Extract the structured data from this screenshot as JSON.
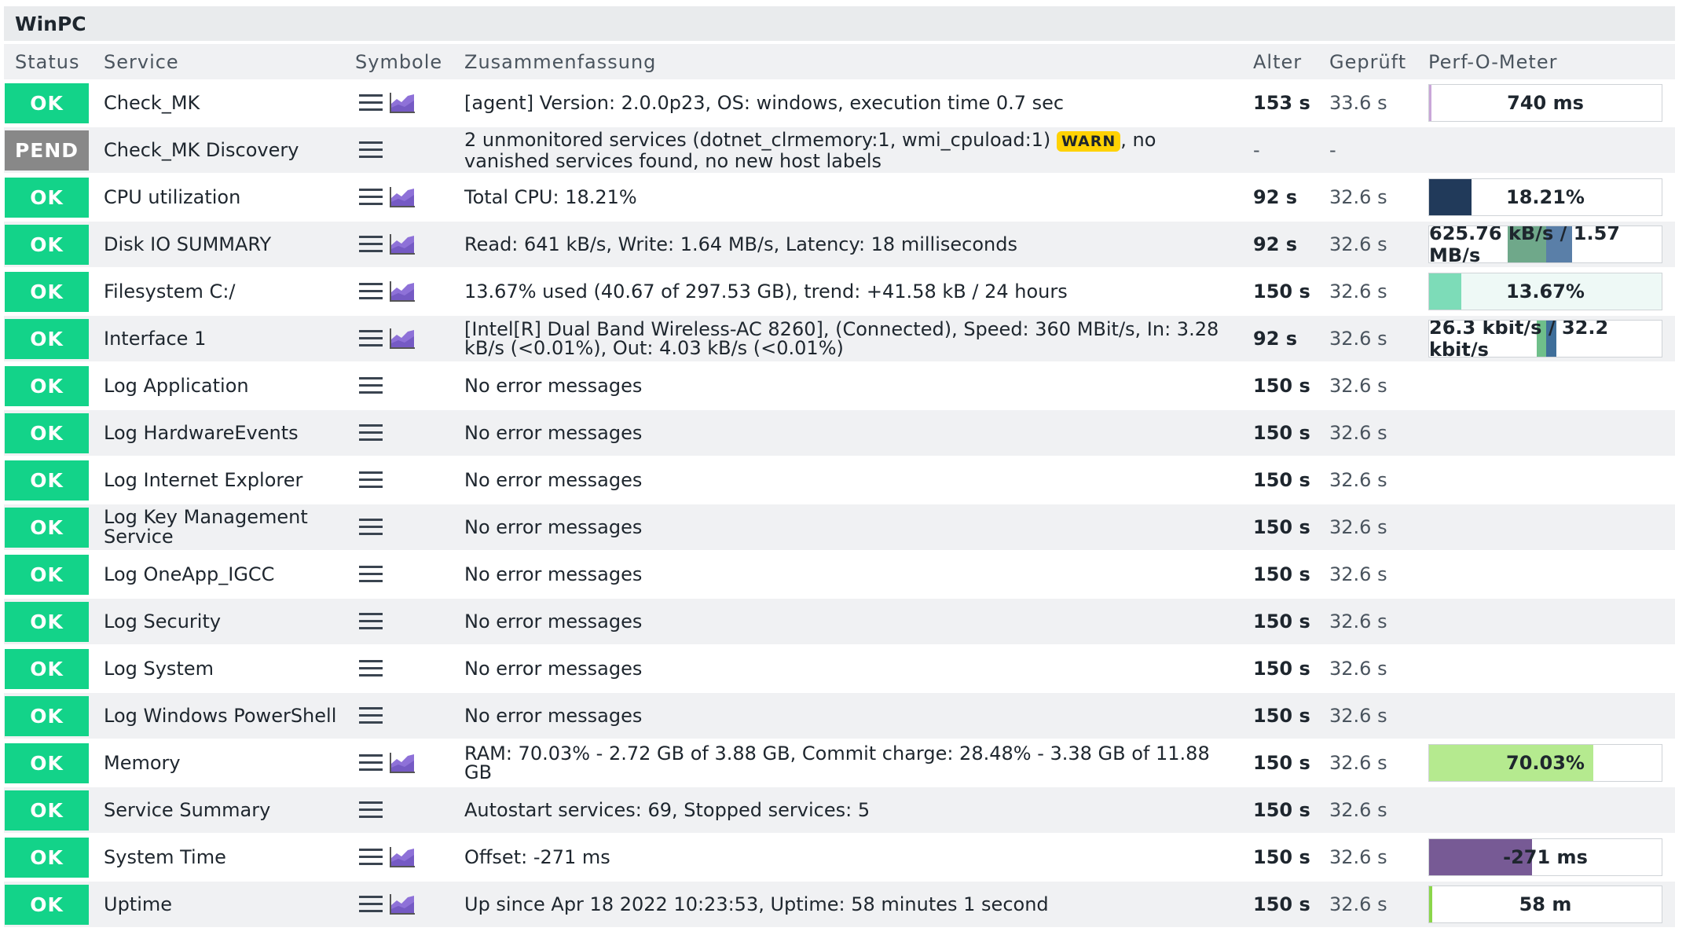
{
  "host": {
    "name": "WinPC"
  },
  "columns": {
    "status": "Status",
    "service": "Service",
    "symbols": "Symbole",
    "summary": "Zusammenfassung",
    "age": "Alter",
    "checked": "Geprüft",
    "perf": "Perf-O-Meter"
  },
  "colors": {
    "ok": "#13d389",
    "pend": "#888888",
    "warn": "#ffd203",
    "graph_icon": "#8e71d8"
  },
  "rows": [
    {
      "status": "OK",
      "service": "Check_MK",
      "graph": true,
      "summary": "[agent] Version: 2.0.0p23, OS: windows, execution time 0.7 sec",
      "age": "153 s",
      "checked": "33.6 s",
      "perf": {
        "label": "740 ms",
        "value": 0.01,
        "color": "#c9a7d8"
      }
    },
    {
      "status": "PEND",
      "service": "Check_MK Discovery",
      "graph": false,
      "summary": "2 unmonitored services (dotnet_clrmemory:1, wmi_cpuload:1)",
      "warn": "WARN",
      "summary_after": ", no vanished services found, no new host labels",
      "age": "-",
      "checked": "-",
      "perf": null
    },
    {
      "status": "OK",
      "service": "CPU utilization",
      "graph": true,
      "summary": "Total CPU: 18.21%",
      "age": "92 s",
      "checked": "32.6 s",
      "perf": {
        "label": "18.21%",
        "value": 0.1821,
        "color": "#213a5a"
      }
    },
    {
      "status": "OK",
      "service": "Disk IO SUMMARY",
      "graph": true,
      "summary": "Read: 641 kB/s, Write: 1.64 MB/s, Latency: 18 milliseconds",
      "age": "92 s",
      "checked": "32.6 s",
      "perf": {
        "label": "625.76 kB/s / 1.57 MB/s",
        "value": 0.33,
        "color": "#6fa88a",
        "value2": 0.22,
        "color2": "#5a7fa8"
      }
    },
    {
      "status": "OK",
      "service": "Filesystem C:/",
      "graph": true,
      "summary": "13.67% used (40.67 of 297.53 GB), trend: +41.58 kB / 24 hours",
      "age": "150 s",
      "checked": "32.6 s",
      "perf": {
        "label": "13.67%",
        "value": 0.1367,
        "color": "#7ddcb8",
        "rest_color": "#eef9f6"
      }
    },
    {
      "status": "OK",
      "service": "Interface 1",
      "graph": true,
      "summary": "[Intel[R] Dual Band Wireless-AC 8260], (Connected), Speed: 360 MBit/s, In: 3.28 kB/s (<0.01%), Out: 4.03 kB/s (<0.01%)",
      "age": "92 s",
      "checked": "32.6 s",
      "perf": {
        "label": "26.3 kbit/s / 32.2 kbit/s",
        "value": 0.08,
        "color": "#6fbf8a",
        "value2": 0.09,
        "color2": "#3f6f9a"
      }
    },
    {
      "status": "OK",
      "service": "Log Application",
      "graph": false,
      "summary": "No error messages",
      "age": "150 s",
      "checked": "32.6 s",
      "perf": null
    },
    {
      "status": "OK",
      "service": "Log HardwareEvents",
      "graph": false,
      "summary": "No error messages",
      "age": "150 s",
      "checked": "32.6 s",
      "perf": null
    },
    {
      "status": "OK",
      "service": "Log Internet Explorer",
      "graph": false,
      "summary": "No error messages",
      "age": "150 s",
      "checked": "32.6 s",
      "perf": null
    },
    {
      "status": "OK",
      "service": "Log Key Management Service",
      "graph": false,
      "summary": "No error messages",
      "age": "150 s",
      "checked": "32.6 s",
      "perf": null
    },
    {
      "status": "OK",
      "service": "Log OneApp_IGCC",
      "graph": false,
      "summary": "No error messages",
      "age": "150 s",
      "checked": "32.6 s",
      "perf": null
    },
    {
      "status": "OK",
      "service": "Log Security",
      "graph": false,
      "summary": "No error messages",
      "age": "150 s",
      "checked": "32.6 s",
      "perf": null
    },
    {
      "status": "OK",
      "service": "Log System",
      "graph": false,
      "summary": "No error messages",
      "age": "150 s",
      "checked": "32.6 s",
      "perf": null
    },
    {
      "status": "OK",
      "service": "Log Windows PowerShell",
      "graph": false,
      "summary": "No error messages",
      "age": "150 s",
      "checked": "32.6 s",
      "perf": null
    },
    {
      "status": "OK",
      "service": "Memory",
      "graph": true,
      "summary": "RAM: 70.03% - 2.72 GB of 3.88 GB, Commit charge: 28.48% - 3.38 GB of 11.88 GB",
      "age": "150 s",
      "checked": "32.6 s",
      "perf": {
        "label": "70.03%",
        "value": 0.7003,
        "color": "#b5ea8f"
      }
    },
    {
      "status": "OK",
      "service": "Service Summary",
      "graph": false,
      "summary": "Autostart services: 69, Stopped services: 5",
      "age": "150 s",
      "checked": "32.6 s",
      "perf": null
    },
    {
      "status": "OK",
      "service": "System Time",
      "graph": true,
      "summary": "Offset: -271 ms",
      "age": "150 s",
      "checked": "32.6 s",
      "perf": {
        "label": "-271 ms",
        "value": 0.44,
        "color": "#775a95"
      }
    },
    {
      "status": "OK",
      "service": "Uptime",
      "graph": true,
      "summary": "Up since Apr 18 2022 10:23:53, Uptime: 58 minutes 1 second",
      "age": "150 s",
      "checked": "32.6 s",
      "perf": {
        "label": "58 m",
        "value": 0.015,
        "color": "#8bd64a"
      }
    }
  ]
}
